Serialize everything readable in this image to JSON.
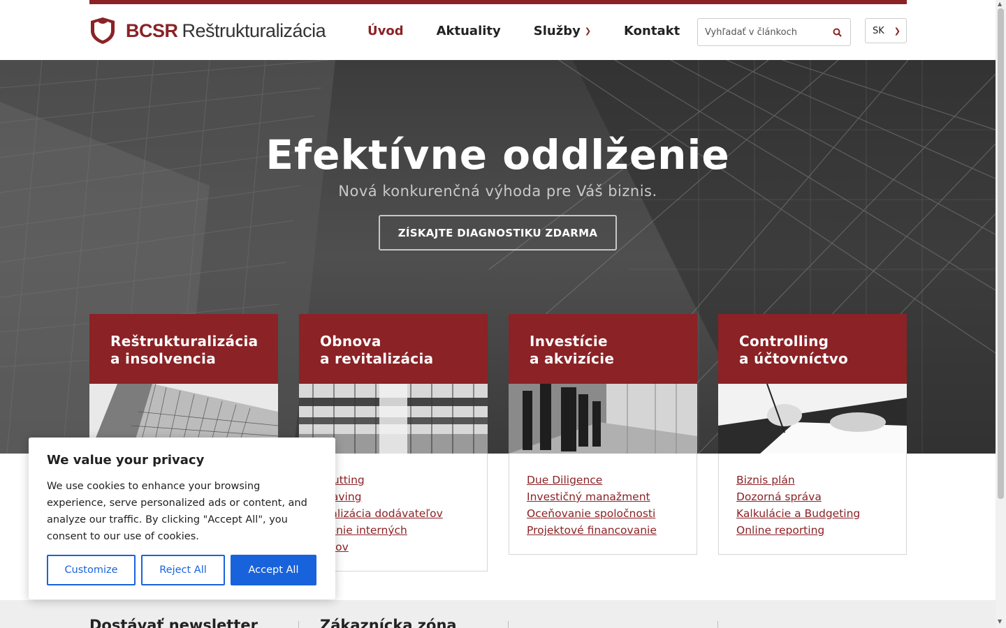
{
  "header": {
    "logo_brand": "BCSR",
    "logo_sub": "Reštrukturalizácia",
    "nav": [
      {
        "label": "Úvod",
        "active": true
      },
      {
        "label": "Aktuality"
      },
      {
        "label": "Služby",
        "has_dropdown": true
      },
      {
        "label": "Kontakt"
      }
    ],
    "search_placeholder": "Vyhľadať v článkoch",
    "language": "SK"
  },
  "hero": {
    "title": "Efektívne oddlženie",
    "subtitle": "Nová konkurenčná výhoda pre Váš biznis.",
    "cta": "ZÍSKAJTE DIAGNOSTIKU ZDARMA"
  },
  "services": [
    {
      "title_line1": "Reštrukturalizácia",
      "title_line2": "a insolvencia",
      "links": []
    },
    {
      "title_line1": "Obnova",
      "title_line2": "a revitalizácia",
      "links": [
        "t Cutting",
        "t Saving",
        "imalizácia dodávateľov",
        "ošenie interných",
        "cesov"
      ]
    },
    {
      "title_line1": "Investície",
      "title_line2": "a akvizície",
      "links": [
        "Due Diligence",
        "Investičný manažment",
        "Oceňovanie spoločnosti",
        "Projektové financovanie"
      ]
    },
    {
      "title_line1": "Controlling",
      "title_line2": "a účtovníctvo",
      "links": [
        "Biznis plán",
        "Dozorná správa",
        "Kalkulácie a Budgeting",
        "Online reporting"
      ]
    }
  ],
  "footer": {
    "col1": "Dostávať newsletter",
    "col2": "Zákaznícka zóna"
  },
  "cookie": {
    "title": "We value your privacy",
    "text": "We use cookies to enhance your browsing experience, serve personalized ads or content, and analyze our traffic. By clicking \"Accept All\", you consent to our use of cookies.",
    "customize": "Customize",
    "reject": "Reject All",
    "accept": "Accept All"
  },
  "colors": {
    "brand": "#8b2226",
    "cookie_accent": "#1863dc"
  }
}
